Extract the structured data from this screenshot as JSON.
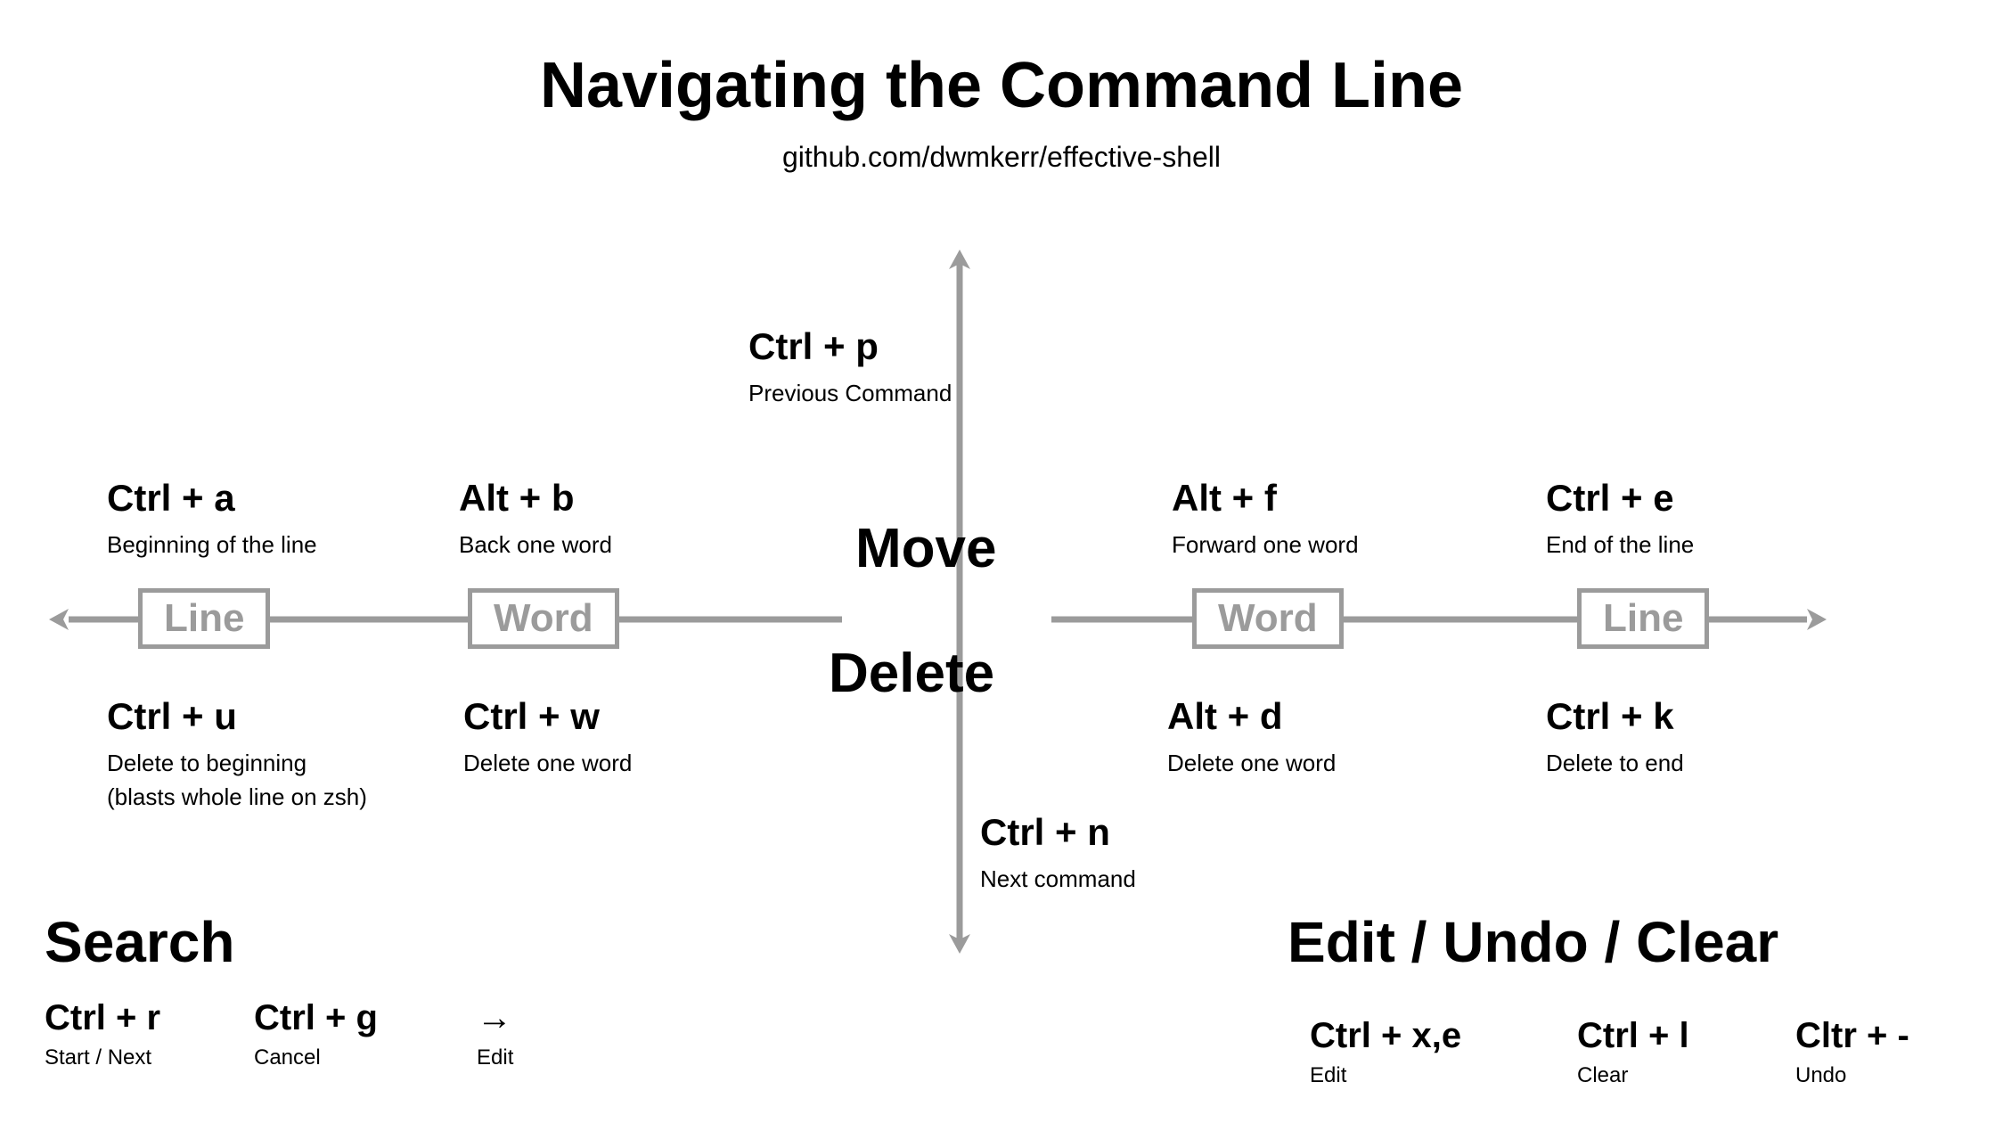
{
  "title": "Navigating the Command Line",
  "subtitle": "github.com/dwmkerr/effective-shell",
  "center": {
    "move": "Move",
    "delete": "Delete"
  },
  "top": {
    "key": "Ctrl + p",
    "desc": "Previous Command"
  },
  "bottom": {
    "key": "Ctrl + n",
    "desc": "Next command"
  },
  "left": {
    "line_badge": "Line",
    "word_badge": "Word",
    "move_line": {
      "key": "Ctrl + a",
      "desc": "Beginning of the line"
    },
    "move_word": {
      "key": "Alt + b",
      "desc": "Back one word"
    },
    "delete_line": {
      "key": "Ctrl + u",
      "desc": "Delete to beginning",
      "desc2": "(blasts whole line on zsh)"
    },
    "delete_word": {
      "key": "Ctrl + w",
      "desc": "Delete one word"
    }
  },
  "right": {
    "word_badge": "Word",
    "line_badge": "Line",
    "move_word": {
      "key": "Alt + f",
      "desc": "Forward one word"
    },
    "move_line": {
      "key": "Ctrl + e",
      "desc": "End of the line"
    },
    "delete_word": {
      "key": "Alt + d",
      "desc": "Delete one word"
    },
    "delete_line": {
      "key": "Ctrl + k",
      "desc": "Delete to end"
    }
  },
  "search": {
    "heading": "Search",
    "items": [
      {
        "key": "Ctrl + r",
        "desc": "Start / Next"
      },
      {
        "key": "Ctrl + g",
        "desc": "Cancel"
      },
      {
        "key": "→",
        "desc": "Edit"
      }
    ]
  },
  "editundo": {
    "heading": "Edit / Undo / Clear",
    "items": [
      {
        "key": "Ctrl + x,e",
        "desc": "Edit"
      },
      {
        "key": "Ctrl + l",
        "desc": "Clear"
      },
      {
        "key": "Cltr + -",
        "desc": "Undo"
      }
    ]
  }
}
